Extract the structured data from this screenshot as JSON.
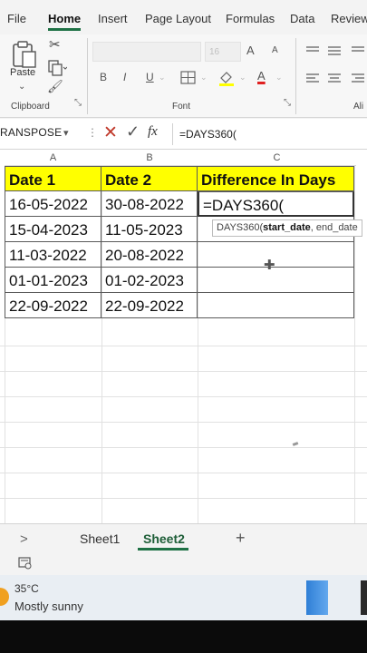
{
  "menu": {
    "tabs": [
      "File",
      "Home",
      "Insert",
      "Page Layout",
      "Formulas",
      "Data",
      "Review"
    ],
    "active_tab": "Home"
  },
  "ribbon": {
    "paste_label": "Paste",
    "clipboard_label": "Clipboard",
    "font_label": "Font",
    "font_size": "16",
    "bold": "B",
    "italic": "I",
    "underline": "U",
    "grow_font": "A",
    "shrink_font": "A",
    "font_color": "A",
    "alignment_label_partial": "Ali"
  },
  "formula_bar": {
    "name_box": "RANSPOSE",
    "fx": "fx",
    "formula": "=DAYS360("
  },
  "grid": {
    "column_headers": [
      "A",
      "B",
      "C"
    ],
    "table_headers": [
      "Date 1",
      "Date 2",
      "Difference In Days"
    ],
    "rows": [
      [
        "16-05-2022",
        "30-08-2022",
        "=DAYS360("
      ],
      [
        "15-04-2023",
        "11-05-2023",
        ""
      ],
      [
        "11-03-2022",
        "20-08-2022",
        ""
      ],
      [
        "01-01-2023",
        "01-02-2023",
        ""
      ],
      [
        "22-09-2022",
        "22-09-2022",
        ""
      ]
    ],
    "header_fill_color": "#ffff00"
  },
  "tooltip": {
    "function": "DAYS360(",
    "active_arg": "start_date",
    "rest": ", end_date"
  },
  "sheets": {
    "tabs": [
      "Sheet1",
      "Sheet2"
    ],
    "active": "Sheet2",
    "add": "+",
    "nav": ">"
  },
  "taskbar": {
    "temperature": "35°C",
    "condition": "Mostly sunny"
  },
  "colors": {
    "accent": "#1e7145",
    "cancel_x": "#c0392b"
  }
}
